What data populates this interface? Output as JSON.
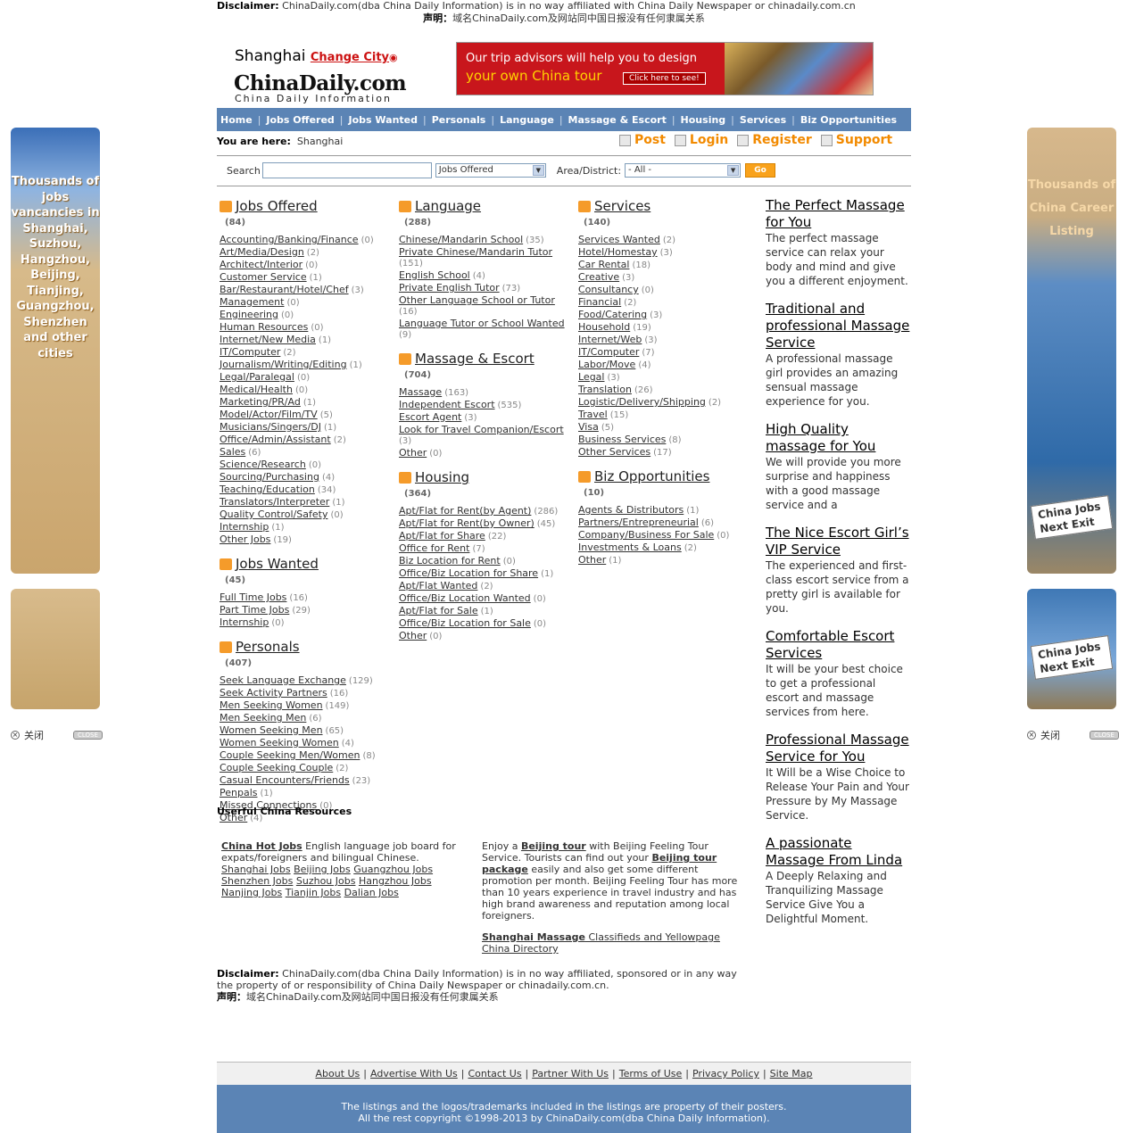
{
  "disclaimer_top": {
    "label": "Disclaimer:",
    "text": " ChinaDaily.com(dba China Daily Information) is in no way affiliated with China Daily Newspaper or chinadaily.com.cn",
    "cn_label": "声明：",
    "cn_text": "域名ChinaDaily.com及网站同中国日报没有任何隶属关系"
  },
  "header": {
    "city": "Shanghai",
    "change_city": "Change City",
    "logo_main": "ChinaDaily",
    "logo_dot": ".com",
    "logo_sub": "China Daily Information"
  },
  "banner": {
    "line1": "Our trip advisors will help you to design",
    "line2": "your own China tour",
    "cta": "Click here to see!"
  },
  "nav": [
    "Home",
    "Jobs Offered",
    "Jobs Wanted",
    "Personals",
    "Language",
    "Massage & Escort",
    "Housing",
    "Services",
    "Biz Opportunities"
  ],
  "breadcrumb": {
    "label": "You are here:",
    "value": "Shanghai"
  },
  "actions": [
    "Post",
    "Login",
    "Register",
    "Support"
  ],
  "search": {
    "label": "Search",
    "category": "Jobs Offered",
    "area_label": "Area/District:",
    "area": "- All -",
    "go": "Go"
  },
  "col1": [
    {
      "title": "Jobs Offered",
      "count": "(84)",
      "items": [
        {
          "name": "Accounting/Banking/Finance",
          "n": "(0)"
        },
        {
          "name": "Art/Media/Design",
          "n": "(2)"
        },
        {
          "name": "Architect/Interior",
          "n": "(0)"
        },
        {
          "name": "Customer Service",
          "n": "(1)"
        },
        {
          "name": "Bar/Restaurant/Hotel/Chef",
          "n": "(3)"
        },
        {
          "name": "Management",
          "n": "(0)"
        },
        {
          "name": "Engineering",
          "n": "(0)"
        },
        {
          "name": "Human Resources",
          "n": "(0)"
        },
        {
          "name": "Internet/New Media",
          "n": "(1)"
        },
        {
          "name": "IT/Computer",
          "n": "(2)"
        },
        {
          "name": "Journalism/Writing/Editing",
          "n": "(1)"
        },
        {
          "name": "Legal/Paralegal",
          "n": "(0)"
        },
        {
          "name": "Medical/Health",
          "n": "(0)"
        },
        {
          "name": "Marketing/PR/Ad",
          "n": "(1)"
        },
        {
          "name": "Model/Actor/Film/TV",
          "n": "(5)"
        },
        {
          "name": "Musicians/Singers/DJ",
          "n": "(1)"
        },
        {
          "name": "Office/Admin/Assistant",
          "n": "(2)"
        },
        {
          "name": "Sales",
          "n": "(6)"
        },
        {
          "name": "Science/Research",
          "n": "(0)"
        },
        {
          "name": "Sourcing/Purchasing",
          "n": "(4)"
        },
        {
          "name": "Teaching/Education",
          "n": "(34)"
        },
        {
          "name": "Translators/Interpreter",
          "n": "(1)"
        },
        {
          "name": "Quality Control/Safety",
          "n": "(0)"
        },
        {
          "name": "Internship",
          "n": "(1)"
        },
        {
          "name": "Other Jobs",
          "n": "(19)"
        }
      ]
    },
    {
      "title": "Jobs Wanted",
      "count": "(45)",
      "items": [
        {
          "name": "Full Time Jobs",
          "n": "(16)"
        },
        {
          "name": "Part Time Jobs",
          "n": "(29)"
        },
        {
          "name": "Internship",
          "n": "(0)"
        }
      ]
    },
    {
      "title": "Personals",
      "count": "(407)",
      "items": [
        {
          "name": "Seek Language Exchange",
          "n": "(129)"
        },
        {
          "name": "Seek Activity Partners",
          "n": "(16)"
        },
        {
          "name": "Men Seeking Women",
          "n": "(149)"
        },
        {
          "name": "Men Seeking Men",
          "n": "(6)"
        },
        {
          "name": "Women Seeking Men",
          "n": "(65)"
        },
        {
          "name": "Women Seeking Women",
          "n": "(4)"
        },
        {
          "name": "Couple Seeking Men/Women",
          "n": "(8)"
        },
        {
          "name": "Couple Seeking Couple",
          "n": "(2)"
        },
        {
          "name": "Casual Encounters/Friends",
          "n": "(23)"
        },
        {
          "name": "Penpals",
          "n": "(1)"
        },
        {
          "name": "Missed Connections",
          "n": "(0)"
        },
        {
          "name": "Other",
          "n": "(4)"
        }
      ]
    }
  ],
  "col2": [
    {
      "title": "Language",
      "count": "(288)",
      "items": [
        {
          "name": "Chinese/Mandarin School",
          "n": "(35)"
        },
        {
          "name": "Private Chinese/Mandarin Tutor",
          "n": "(151)",
          "wrap": true
        },
        {
          "name": "English School",
          "n": "(4)"
        },
        {
          "name": "Private English Tutor",
          "n": "(73)"
        },
        {
          "name": "Other Language School or Tutor",
          "n": "(16)",
          "wrap": true
        },
        {
          "name": "Language Tutor or School Wanted",
          "n": "(9)",
          "wrap": true
        }
      ]
    },
    {
      "title": "Massage & Escort",
      "count": "(704)",
      "items": [
        {
          "name": "Massage",
          "n": "(163)"
        },
        {
          "name": "Independent Escort",
          "n": "(535)"
        },
        {
          "name": "Escort Agent",
          "n": "(3)"
        },
        {
          "name": "Look for Travel Companion/Escort",
          "n": "(3)",
          "wrap": true
        },
        {
          "name": "Other",
          "n": "(0)"
        }
      ]
    },
    {
      "title": "Housing",
      "count": "(364)",
      "items": [
        {
          "name": "Apt/Flat for Rent(by Agent)",
          "n": "(286)"
        },
        {
          "name": "Apt/Flat for Rent(by Owner)",
          "n": "(45)"
        },
        {
          "name": "Apt/Flat for Share",
          "n": "(22)"
        },
        {
          "name": "Office for Rent",
          "n": "(7)"
        },
        {
          "name": "Biz Location for Rent",
          "n": "(0)"
        },
        {
          "name": "Office/Biz Location for Share",
          "n": "(1)"
        },
        {
          "name": "Apt/Flat Wanted",
          "n": "(2)"
        },
        {
          "name": "Office/Biz Location Wanted",
          "n": "(0)"
        },
        {
          "name": "Apt/Flat for Sale",
          "n": "(1)"
        },
        {
          "name": "Office/Biz Location for Sale",
          "n": "(0)"
        },
        {
          "name": "Other",
          "n": "(0)"
        }
      ]
    }
  ],
  "col3": [
    {
      "title": "Services",
      "count": "(140)",
      "items": [
        {
          "name": "Services Wanted",
          "n": "(2)"
        },
        {
          "name": "Hotel/Homestay",
          "n": "(3)"
        },
        {
          "name": "Car Rental",
          "n": "(18)"
        },
        {
          "name": "Creative",
          "n": "(3)"
        },
        {
          "name": "Consultancy",
          "n": "(0)"
        },
        {
          "name": "Financial",
          "n": "(2)"
        },
        {
          "name": "Food/Catering",
          "n": "(3)"
        },
        {
          "name": "Household",
          "n": "(19)"
        },
        {
          "name": "Internet/Web",
          "n": "(3)"
        },
        {
          "name": "IT/Computer",
          "n": "(7)"
        },
        {
          "name": "Labor/Move",
          "n": "(4)"
        },
        {
          "name": "Legal",
          "n": "(3)"
        },
        {
          "name": "Translation",
          "n": "(26)"
        },
        {
          "name": "Logistic/Delivery/Shipping",
          "n": "(2)"
        },
        {
          "name": "Travel",
          "n": "(15)"
        },
        {
          "name": "Visa",
          "n": "(5)"
        },
        {
          "name": "Business Services",
          "n": "(8)"
        },
        {
          "name": "Other Services",
          "n": "(17)"
        }
      ]
    },
    {
      "title": "Biz Opportunities",
      "count": "(10)",
      "items": [
        {
          "name": "Agents & Distributors",
          "n": "(1)"
        },
        {
          "name": "Partners/Entrepreneurial",
          "n": "(6)"
        },
        {
          "name": "Company/Business For Sale",
          "n": "(0)"
        },
        {
          "name": "Investments & Loans",
          "n": "(2)"
        },
        {
          "name": "Other",
          "n": "(1)"
        }
      ]
    }
  ],
  "right_ads": [
    {
      "title": "The Perfect Massage for You",
      "desc": "The perfect massage service can relax your body and mind and give you a different enjoyment."
    },
    {
      "title": "Traditional and professional Massage Service",
      "desc": "A professional massage girl provides an amazing sensual massage experience for you."
    },
    {
      "title": "High Quality massage for You",
      "desc": "We will provide you more surprise and happiness with a good massage service and a"
    },
    {
      "title": "The Nice Escort Girl’s VIP Service",
      "desc": "The experienced and first-class escort service from a pretty girl is available for you."
    },
    {
      "title": "Comfortable Escort Services",
      "desc": "It will be your best choice to get a professional escort and massage services from here."
    },
    {
      "title": "Professional Massage Service for You",
      "desc": "It Will be a Wise Choice to Release Your Pain and Your Pressure by My Massage Service."
    },
    {
      "title": "A passionate Massage From Linda",
      "desc": "A Deeply Relaxing and Tranquilizing Massage Service Give You a Delightful Moment."
    }
  ],
  "resources": {
    "heading": "Userful China Resources",
    "left": {
      "bold_link": "China Hot Jobs",
      "desc": " English language job board for expats/foreigners and bilingual Chinese.",
      "links": [
        "Shanghai Jobs",
        "Beijing Jobs",
        "Guangzhou Jobs",
        "Shenzhen Jobs",
        "Suzhou Jobs",
        "Hangzhou Jobs",
        "Nanjing Jobs",
        "Tianjin Jobs",
        "Dalian Jobs"
      ]
    },
    "right": {
      "p1a": "Enjoy a ",
      "p1b": "Beijing tour",
      "p1c": " with Beijing Feeling Tour Service. Tourists can find out your ",
      "p1d": "Beijing tour package",
      "p1e": " easily and also get some different promotion per month. Beijing Feeling Tour has more than 10 years experience in travel industry and has high brand awareness and reputation among local foreigners.",
      "p2a": "Shanghai Massage",
      "p2b": " Classifieds and Yellowpage China Directory"
    }
  },
  "disclaimer_bottom": {
    "label": "Disclaimer:",
    "text": " ChinaDaily.com(dba China Daily Information) is in no way affiliated, sponsored or in any way the property of or responsibility of China Daily Newspaper or chinadaily.com.cn.",
    "cn_label": "声明：",
    "cn_text": "域名ChinaDaily.com及网站同中国日报没有任何隶属关系"
  },
  "footer": {
    "links": [
      "About Us",
      "Advertise With Us",
      "Contact Us",
      "Partner With Us",
      "Terms of Use",
      "Privacy Policy",
      "Site Map"
    ],
    "line1": "The listings and the logos/trademarks included in the listings are property of their posters.",
    "line2": "All the rest copyright ©1998-2013 by ChinaDaily.com(dba China Daily Information)."
  },
  "side_ads": {
    "left_text": "Thousands of jobs vancancies in Shanghai, Suzhou, Hangzhou, Beijing, Tianjing, Guangzhou, Shenzhen and other cities",
    "right_text": "Thousands of China Career Listing",
    "sign": "China Jobs Next Exit",
    "close_cn": "关闭",
    "close_en": "CLOSE"
  },
  "colors": {
    "nav": "#5b84b5",
    "accent": "#f28a00",
    "brand_red": "#cc1111"
  }
}
